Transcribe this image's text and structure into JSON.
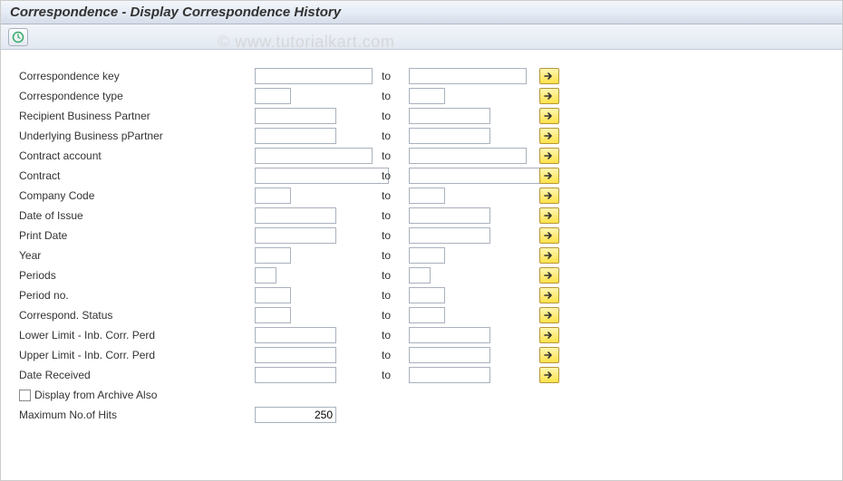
{
  "title": "Correspondence - Display Correspondence History",
  "watermark": "© www.tutorialkart.com",
  "to_label": "to",
  "rows": [
    {
      "label": "Correspondence key",
      "fw": "w-full",
      "tw": "w-full"
    },
    {
      "label": "Correspondence type",
      "fw": "w-short",
      "tw": "w-short"
    },
    {
      "label": "Recipient Business Partner",
      "fw": "w-med",
      "tw": "w-med"
    },
    {
      "label": "Underlying Business pPartner",
      "fw": "w-med",
      "tw": "w-med"
    },
    {
      "label": "Contract account",
      "fw": "w-full",
      "tw": "w-full"
    },
    {
      "label": "Contract",
      "fw": "w-xl",
      "tw": "w-xl"
    },
    {
      "label": "Company Code",
      "fw": "w-short",
      "tw": "w-short"
    },
    {
      "label": "Date of Issue",
      "fw": "w-med",
      "tw": "w-med"
    },
    {
      "label": "Print Date",
      "fw": "w-med",
      "tw": "w-med"
    },
    {
      "label": "Year",
      "fw": "w-short",
      "tw": "w-short"
    },
    {
      "label": "Periods",
      "fw": "w-tiny",
      "tw": "w-tiny"
    },
    {
      "label": "Period no.",
      "fw": "w-short",
      "tw": "w-short"
    },
    {
      "label": "Correspond. Status",
      "fw": "w-short",
      "tw": "w-short"
    },
    {
      "label": "Lower Limit - Inb. Corr. Perd",
      "fw": "w-med",
      "tw": "w-med"
    },
    {
      "label": "Upper Limit - Inb. Corr. Perd",
      "fw": "w-med",
      "tw": "w-med"
    },
    {
      "label": "Date Received",
      "fw": "w-med",
      "tw": "w-med"
    }
  ],
  "archive_checkbox_label": "Display from Archive Also",
  "max_hits_label": "Maximum No.of Hits",
  "max_hits_value": "250"
}
